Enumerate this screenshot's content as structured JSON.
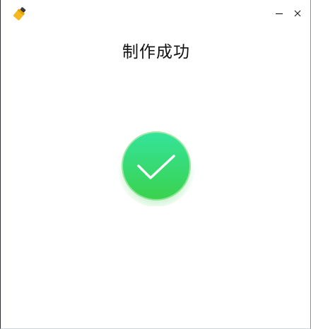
{
  "window": {
    "app_icon": "usb-drive-icon",
    "controls": [
      {
        "name": "minimize",
        "icon": "minimize-icon"
      },
      {
        "name": "close",
        "icon": "close-icon"
      }
    ]
  },
  "main": {
    "title": "制作成功",
    "status_icon": "checkmark-circle-icon"
  },
  "colors": {
    "success_top": "#34e39a",
    "success_bottom": "#3ad24e",
    "check": "#ffffff",
    "app_icon_yellow": "#f5b820",
    "app_icon_dark": "#3a3a3a"
  }
}
